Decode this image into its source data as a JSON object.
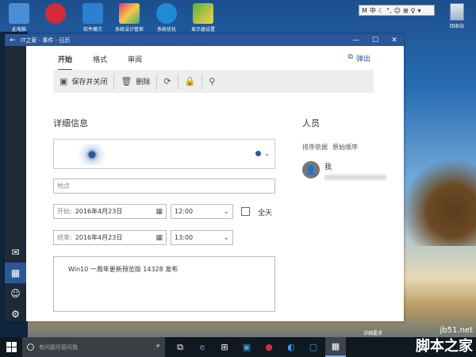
{
  "desktop": {
    "icons": [
      {
        "label": "此电脑",
        "color": "#4a8fd6"
      },
      {
        "label": "",
        "color": "#d12c3a"
      },
      {
        "label": "软件魔方",
        "color": "#2d7fd0"
      },
      {
        "label": "系统设计管家",
        "color": "#e03a6a"
      },
      {
        "label": "系统优化",
        "color": "#1f8bd6"
      },
      {
        "label": "显示器设置",
        "color": "#5fae3a"
      }
    ],
    "recycle_label": "回收站",
    "tray_top": [
      "M",
      "中",
      "☾",
      "°,",
      "☺",
      "⊞",
      "♀",
      "▾"
    ]
  },
  "window": {
    "title": "IT之家 - 事件 - 日历",
    "back_glyph": "←",
    "minimize_glyph": "—",
    "maximize_glyph": "☐",
    "close_glyph": "✕"
  },
  "leftbar": {
    "mail_glyph": "✉",
    "calendar_glyph": "▦",
    "people_glyph": "☺",
    "settings_glyph": "⚙"
  },
  "tabs": [
    {
      "label": "开始",
      "active": true
    },
    {
      "label": "格式",
      "active": false
    },
    {
      "label": "审阅",
      "active": false
    }
  ],
  "popout_label": "弹出",
  "toolbar": {
    "save_close": "保存并关闭",
    "delete": "删除"
  },
  "details": {
    "title": "详细信息",
    "location_placeholder": "地点",
    "start_label": "开始:",
    "start_date": "2016年4月23日",
    "start_time": "12:00",
    "end_label": "结束:",
    "end_date": "2016年4月23日",
    "end_time": "13:00",
    "allday_label": "全天",
    "notes": "Win10 一周年更新预览版 14328 发布"
  },
  "people": {
    "title": "人员",
    "sort_label": "排序依据",
    "sort_value": "原始顺序",
    "me_label": "我"
  },
  "taskbar": {
    "search_placeholder": "有问题尽管问我",
    "mic_glyph": "🎤"
  },
  "notification_text": "详细要求",
  "watermark": {
    "url": "jb51.net",
    "text": "脚本之家"
  },
  "colors": {
    "accent": "#2b579a",
    "taskbar": "#101820"
  }
}
